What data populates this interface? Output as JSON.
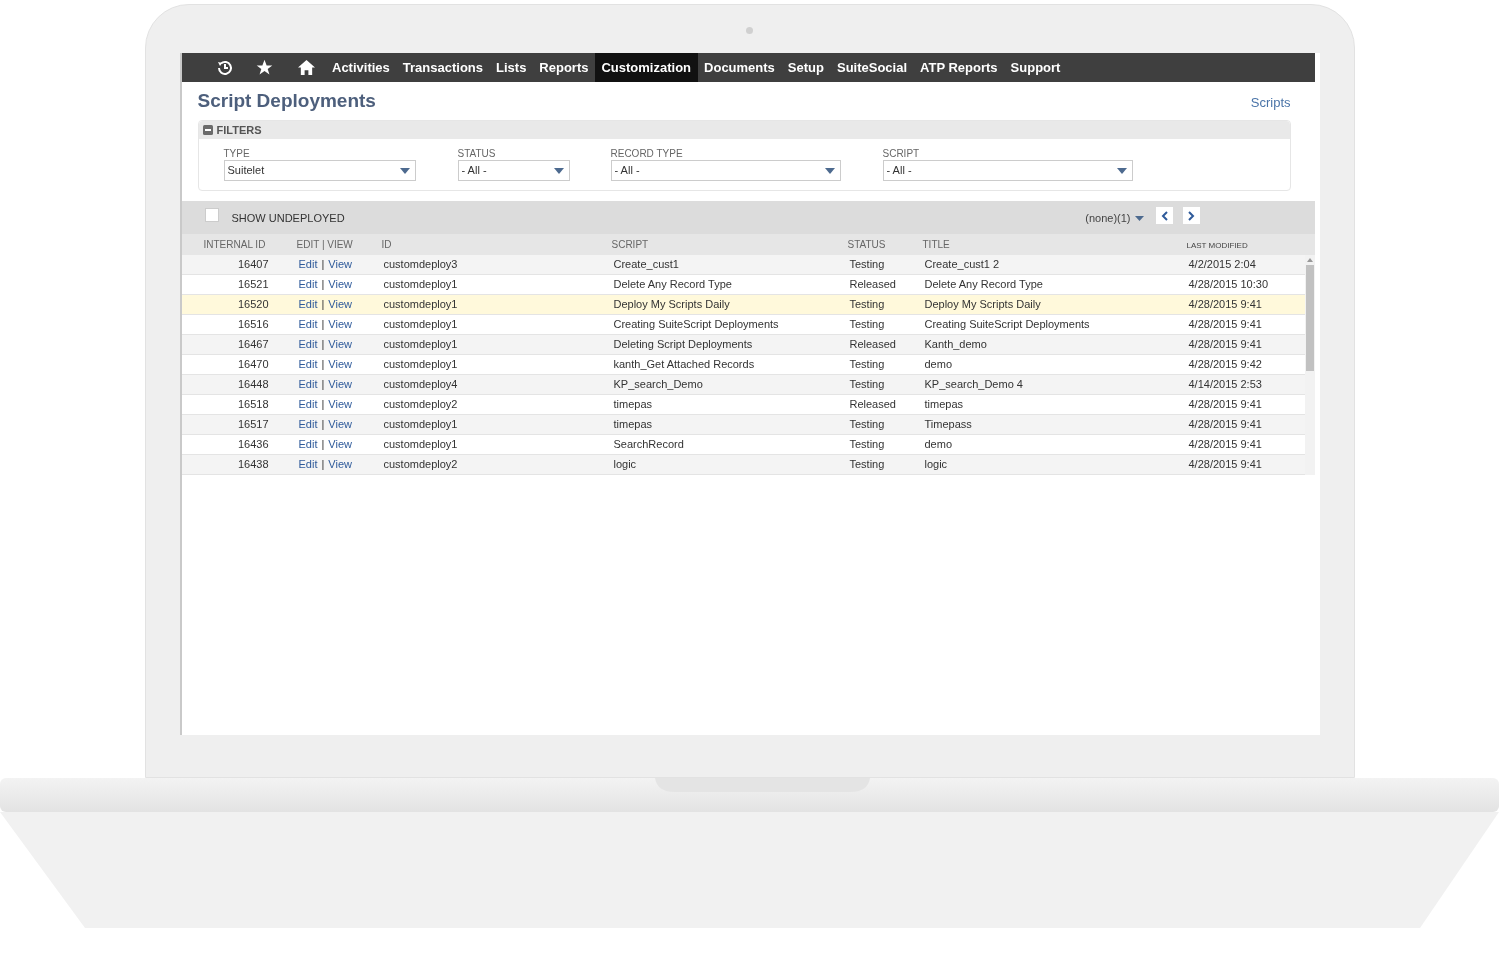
{
  "nav": {
    "items": [
      {
        "label": "Activities",
        "selected": false
      },
      {
        "label": "Transactions",
        "selected": false
      },
      {
        "label": "Lists",
        "selected": false
      },
      {
        "label": "Reports",
        "selected": false
      },
      {
        "label": "Customization",
        "selected": true
      },
      {
        "label": "Documents",
        "selected": false
      },
      {
        "label": "Setup",
        "selected": false
      },
      {
        "label": "SuiteSocial",
        "selected": false
      },
      {
        "label": "ATP Reports",
        "selected": false
      },
      {
        "label": "Support",
        "selected": false
      }
    ]
  },
  "page": {
    "title": "Script Deployments",
    "link": "Scripts"
  },
  "filters": {
    "title": "FILTERS",
    "fields": [
      {
        "label": "TYPE",
        "value": "Suitelet"
      },
      {
        "label": "STATUS",
        "value": "- All -"
      },
      {
        "label": "RECORD TYPE",
        "value": "- All -"
      },
      {
        "label": "SCRIPT",
        "value": "- All -"
      }
    ]
  },
  "show_undeployed": {
    "label": "SHOW UNDEPLOYED",
    "checked": false
  },
  "pager": {
    "label": "(none)(1)"
  },
  "table": {
    "columns": [
      "INTERNAL ID",
      "EDIT | VIEW",
      "ID",
      "SCRIPT",
      "STATUS",
      "TITLE",
      "LAST MODIFIED"
    ],
    "rows": [
      {
        "internal_id": "16407",
        "edit": "Edit",
        "separator": "|",
        "view": "View",
        "id": "customdeploy3",
        "script": "Create_cust1",
        "status": "Testing",
        "title": "Create_cust1 2",
        "last_modified": "4/2/2015 2:04",
        "selected": false
      },
      {
        "internal_id": "16521",
        "edit": "Edit",
        "separator": "|",
        "view": "View",
        "id": "customdeploy1",
        "script": "Delete Any Record Type",
        "status": "Released",
        "title": "Delete Any Record Type",
        "last_modified": "4/28/2015 10:30",
        "selected": false
      },
      {
        "internal_id": "16520",
        "edit": "Edit",
        "separator": "|",
        "view": "View",
        "id": "customdeploy1",
        "script": "Deploy My Scripts Daily",
        "status": "Testing",
        "title": "Deploy My Scripts Daily",
        "last_modified": "4/28/2015 9:41",
        "selected": true
      },
      {
        "internal_id": "16516",
        "edit": "Edit",
        "separator": "|",
        "view": "View",
        "id": "customdeploy1",
        "script": "Creating SuiteScript Deployments",
        "status": "Testing",
        "title": "Creating SuiteScript Deployments",
        "last_modified": "4/28/2015 9:41",
        "selected": false
      },
      {
        "internal_id": "16467",
        "edit": "Edit",
        "separator": "|",
        "view": "View",
        "id": "customdeploy1",
        "script": "Deleting Script Deployments",
        "status": "Released",
        "title": "Kanth_demo",
        "last_modified": "4/28/2015 9:41",
        "selected": false
      },
      {
        "internal_id": "16470",
        "edit": "Edit",
        "separator": "|",
        "view": "View",
        "id": "customdeploy1",
        "script": "kanth_Get Attached Records",
        "status": "Testing",
        "title": "demo",
        "last_modified": "4/28/2015 9:42",
        "selected": false
      },
      {
        "internal_id": "16448",
        "edit": "Edit",
        "separator": "|",
        "view": "View",
        "id": "customdeploy4",
        "script": "KP_search_Demo",
        "status": "Testing",
        "title": "KP_search_Demo 4",
        "last_modified": "4/14/2015 2:53",
        "selected": false
      },
      {
        "internal_id": "16518",
        "edit": "Edit",
        "separator": "|",
        "view": "View",
        "id": "customdeploy2",
        "script": "timepas",
        "status": "Released",
        "title": "timepas",
        "last_modified": "4/28/2015 9:41",
        "selected": false
      },
      {
        "internal_id": "16517",
        "edit": "Edit",
        "separator": "|",
        "view": "View",
        "id": "customdeploy1",
        "script": "timepas",
        "status": "Testing",
        "title": "Timepass",
        "last_modified": "4/28/2015 9:41",
        "selected": false
      },
      {
        "internal_id": "16436",
        "edit": "Edit",
        "separator": "|",
        "view": "View",
        "id": "customdeploy1",
        "script": "SearchRecord",
        "status": "Testing",
        "title": "demo",
        "last_modified": "4/28/2015 9:41",
        "selected": false
      },
      {
        "internal_id": "16438",
        "edit": "Edit",
        "separator": "|",
        "view": "View",
        "id": "customdeploy2",
        "script": "logic",
        "status": "Testing",
        "title": "logic",
        "last_modified": "4/28/2015 9:41",
        "selected": false
      }
    ]
  }
}
